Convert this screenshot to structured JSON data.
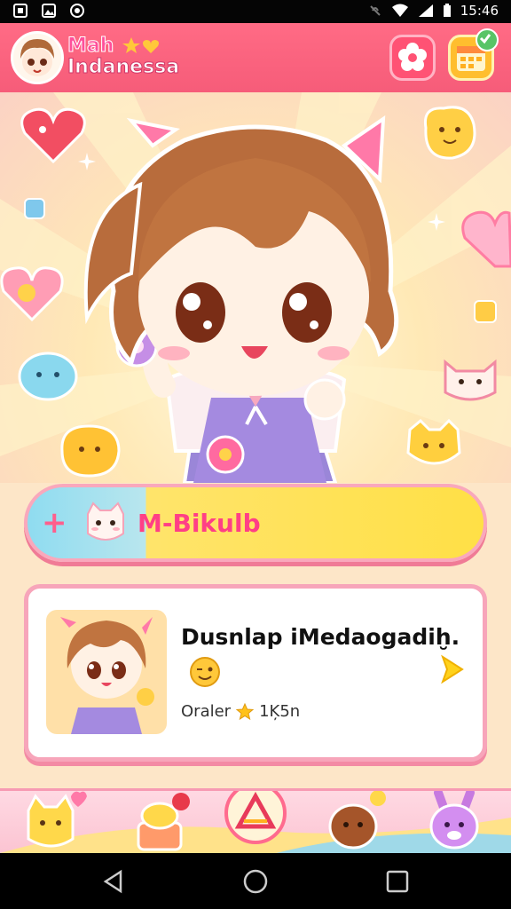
{
  "status_bar": {
    "time": "15:46"
  },
  "header": {
    "title_line1": "Mah",
    "title_line2": "Indanessa",
    "settings_icon": "flower-icon",
    "calendar_icon": "calendar-check-icon"
  },
  "banner": {
    "label": "M-Bikulb",
    "icon": "plus-icon"
  },
  "card": {
    "title": "Dusnlap iMedaogadiḫ.",
    "meta_label": "Oraler",
    "meta_value": "1Ķ5n"
  },
  "bottom_nav": {
    "items": [
      "cat-icon",
      "cake-icon",
      "triangle-ruler-icon",
      "chestnut-icon",
      "bunny-icon"
    ]
  },
  "colors": {
    "header": "#f65c79",
    "accent_pink": "#ff3f86",
    "banner_yellow": "#ffe046",
    "banner_blue": "#8fdcf0",
    "card_border": "#f7a5ba"
  }
}
